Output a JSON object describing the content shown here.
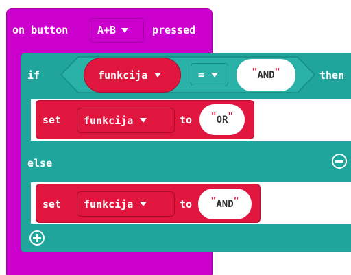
{
  "event": {
    "prefix": "on button",
    "button_value": "A+B",
    "suffix": "pressed"
  },
  "if_block": {
    "if_label": "if",
    "then_label": "then",
    "else_label": "else",
    "condition": {
      "variable": "funkcija",
      "operator": "=",
      "value": "AND"
    }
  },
  "then_branch": {
    "set_label": "set",
    "variable": "funkcija",
    "to_label": "to",
    "value": "OR"
  },
  "else_branch": {
    "set_label": "set",
    "variable": "funkcija",
    "to_label": "to",
    "value": "AND"
  },
  "icons": {
    "remove_else": "minus-circle-icon",
    "add_branch": "plus-circle-icon",
    "dropdown": "triangle-down-icon"
  },
  "colors": {
    "event": "#cc00cc",
    "logic": "#1fa59c",
    "variables": "#e0163e",
    "string": "#ffffff"
  }
}
